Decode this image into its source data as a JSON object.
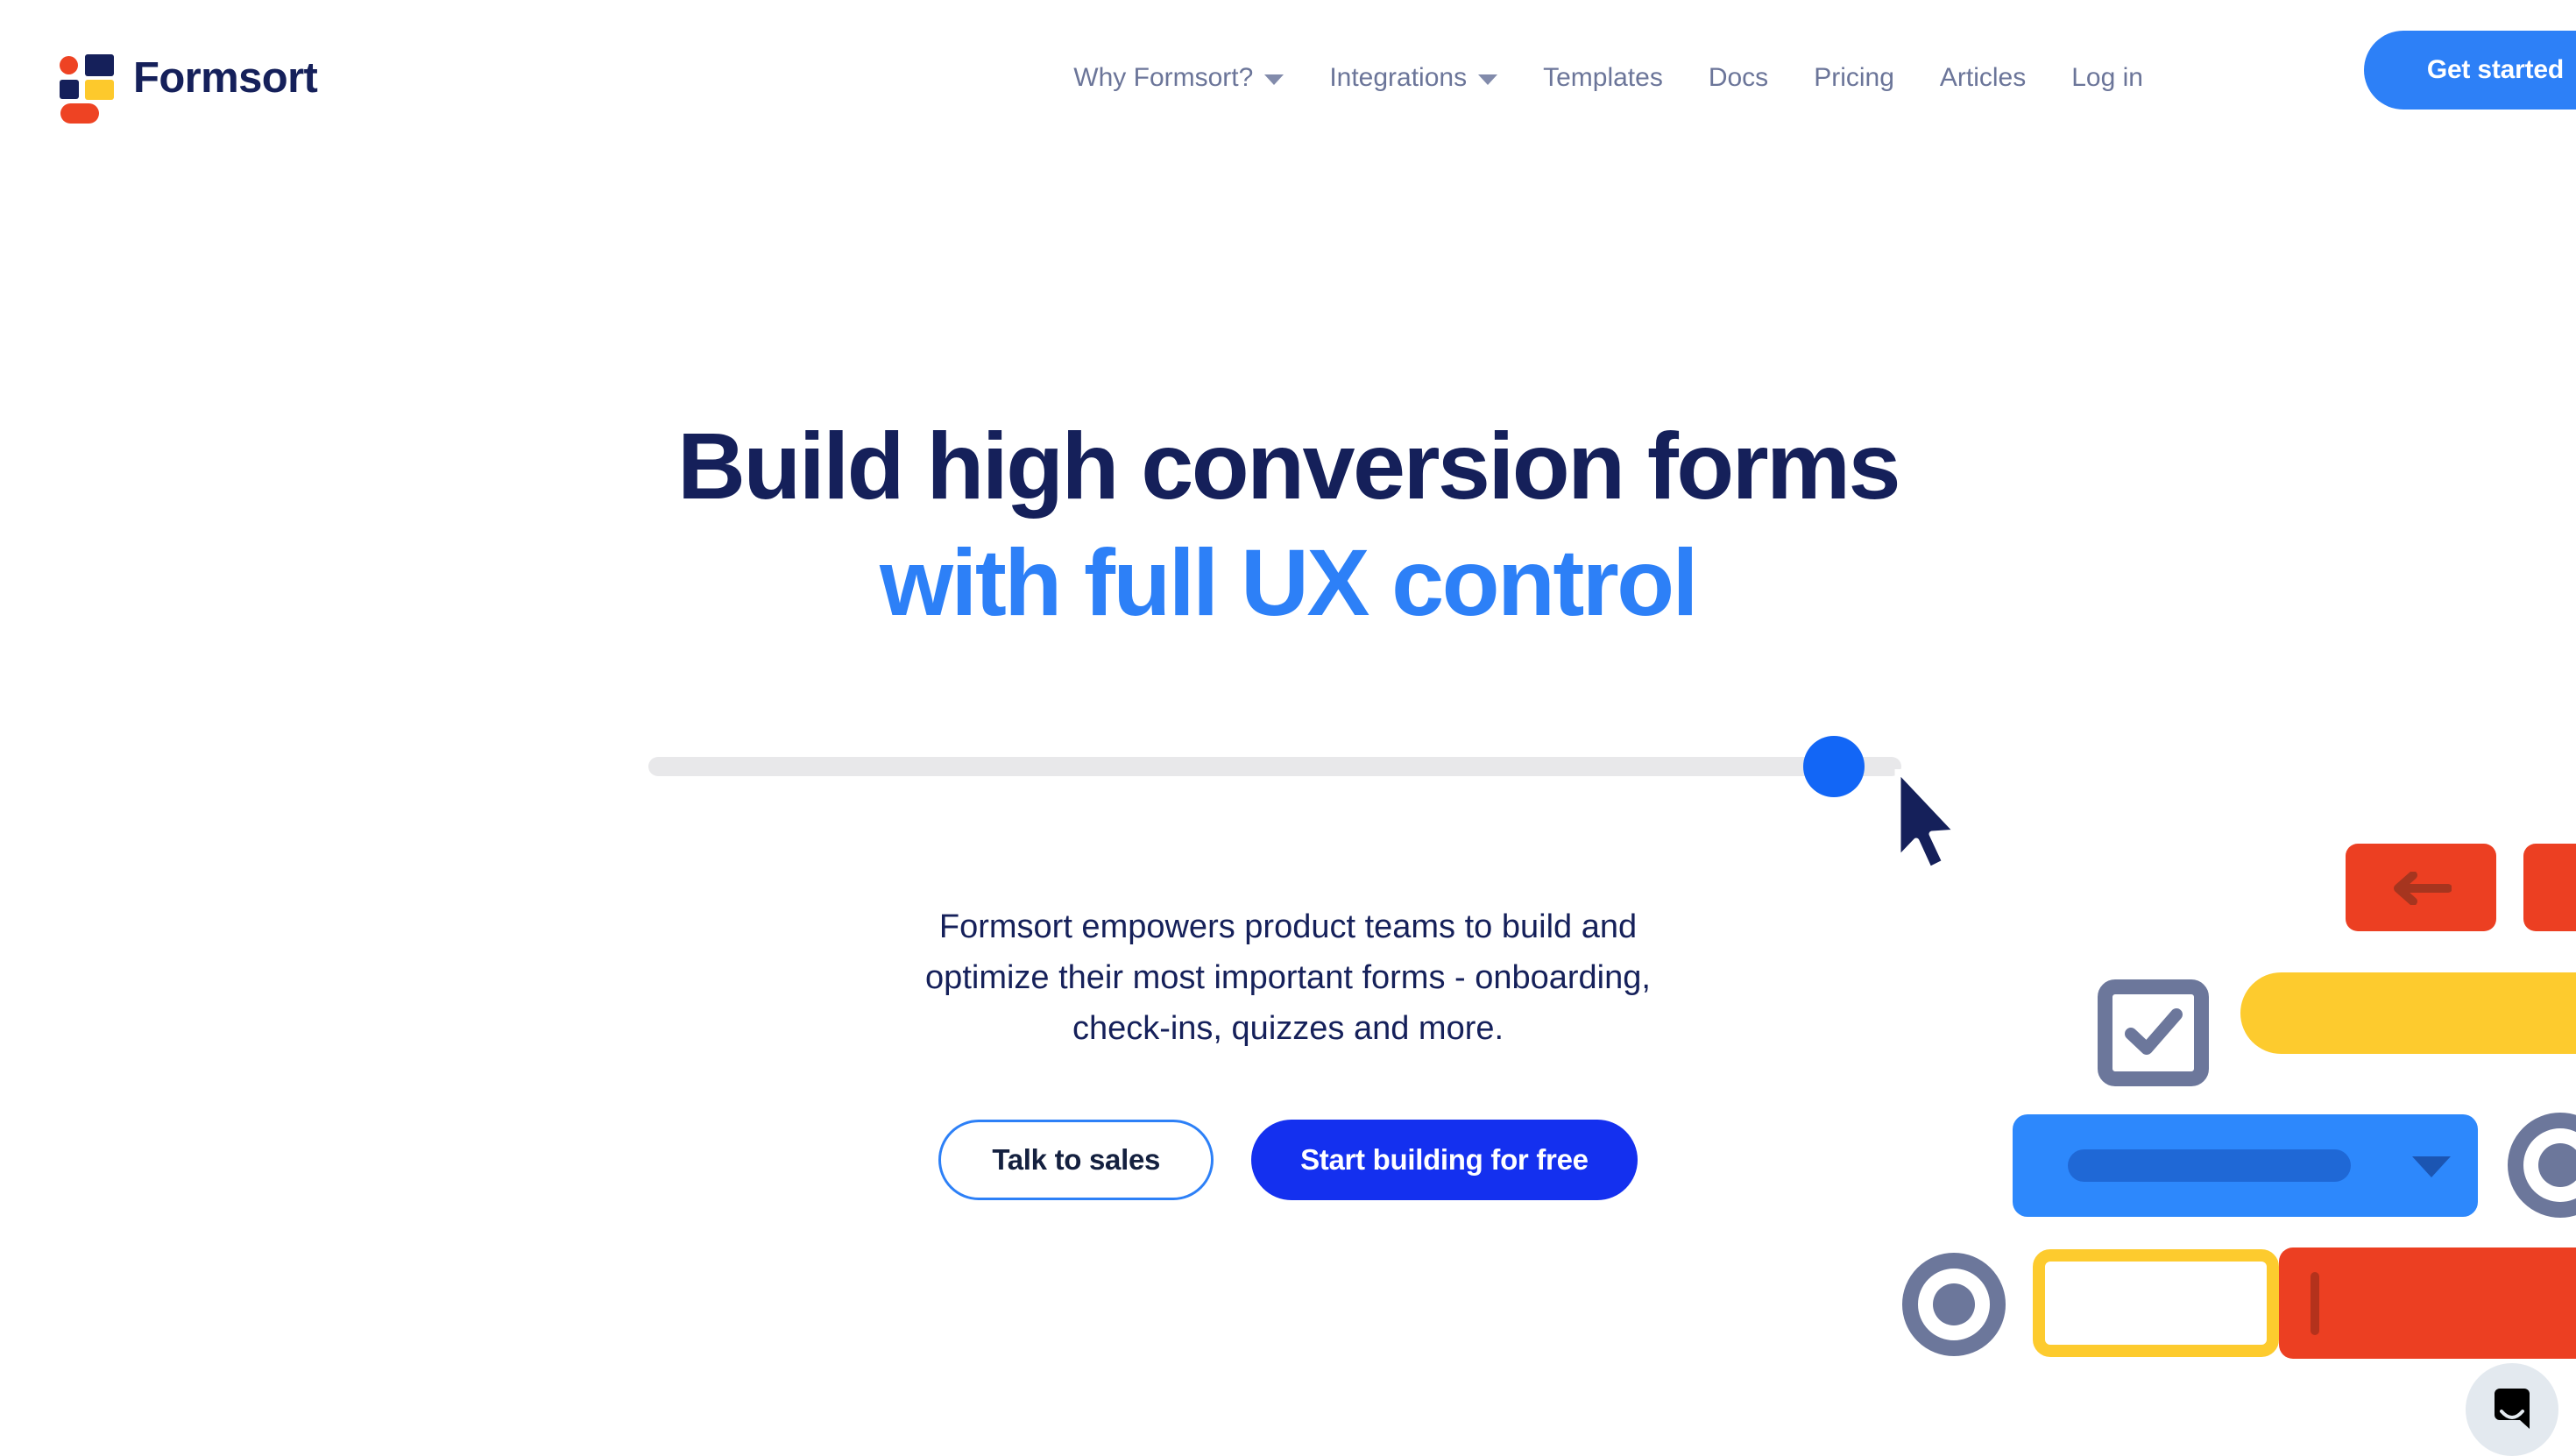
{
  "brand": {
    "name": "Formsort",
    "logo_icon": "formsort-logo-mark",
    "colors": {
      "red": "#EE4323",
      "navy": "#15205A",
      "yellow": "#FDC92C"
    }
  },
  "header": {
    "nav_items": [
      {
        "label": "Why Formsort?",
        "has_dropdown": true,
        "icon": "chevron-down-icon"
      },
      {
        "label": "Integrations",
        "has_dropdown": true,
        "icon": "chevron-down-icon"
      },
      {
        "label": "Templates",
        "has_dropdown": false
      },
      {
        "label": "Docs",
        "has_dropdown": false
      },
      {
        "label": "Pricing",
        "has_dropdown": false
      },
      {
        "label": "Articles",
        "has_dropdown": false
      },
      {
        "label": "Log in",
        "has_dropdown": false
      }
    ],
    "cta_label": "Get started",
    "cta_color": "#2D80F7",
    "nav_text_color": "#6B7599"
  },
  "hero": {
    "headline_line1": "Build high conversion forms",
    "headline_line2": "with full UX control",
    "headline_color_1": "#15205A",
    "headline_color_2": "#2D80F7",
    "paragraph_line1": "Formsort empowers product teams to build and",
    "paragraph_line2": "optimize their most important forms - onboarding,",
    "paragraph_line3": "check-ins, quizzes and more.",
    "slider": {
      "name": "hero-slider",
      "track_color": "#E8E8EA",
      "thumb_color": "#1266F6",
      "value_percent": 93
    },
    "cursor_icon": "mouse-pointer-icon",
    "buttons": [
      {
        "label": "Talk to sales",
        "style": "outline",
        "border_color": "#2D80F7"
      },
      {
        "label": "Start building for free",
        "style": "solid",
        "bg_color": "#1430EF"
      }
    ]
  },
  "decor": {
    "elements": [
      {
        "name": "back-arrow-button",
        "icon": "arrow-left-icon",
        "color": "#EC3F22"
      },
      {
        "name": "red-button-partial",
        "color": "#EC3F22"
      },
      {
        "name": "checkbox-checked",
        "icon": "check-icon",
        "color": "#6C779B"
      },
      {
        "name": "yellow-pill-button",
        "color": "#FDCB2E"
      },
      {
        "name": "select-dropdown",
        "icon": "chevron-down-icon",
        "color": "#2D88FC"
      },
      {
        "name": "radio-selected-right",
        "color": "#6C779B"
      },
      {
        "name": "radio-selected-left",
        "color": "#6C779B"
      },
      {
        "name": "yellow-outlined-input",
        "color": "#FDCB2E"
      },
      {
        "name": "red-text-field",
        "color": "#EC3F22"
      }
    ]
  },
  "chat_widget": {
    "icon": "chat-bubble-icon",
    "bg_color": "#E3E9EF",
    "glyph_color": "#000000"
  }
}
